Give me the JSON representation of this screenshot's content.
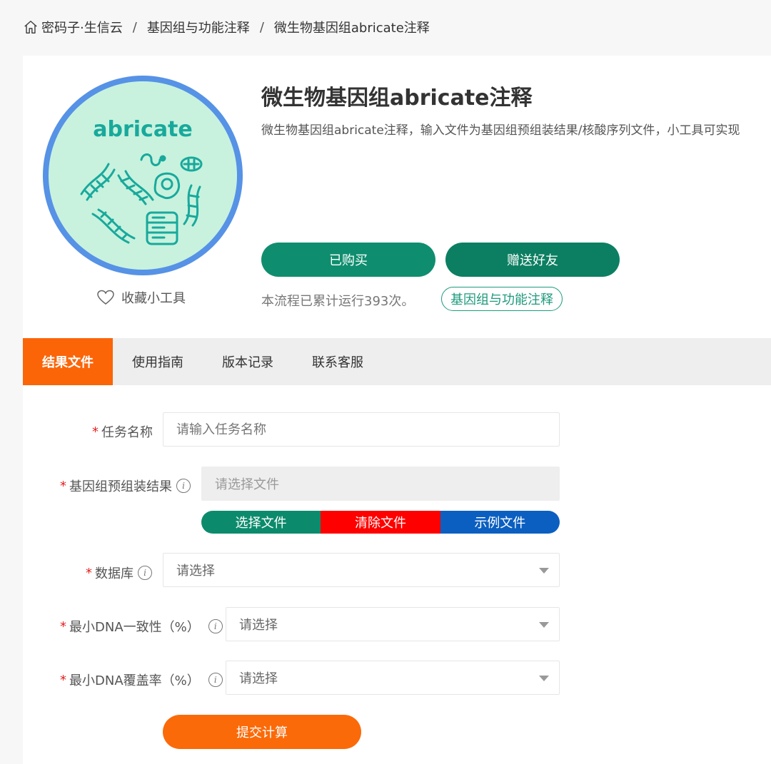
{
  "breadcrumb": {
    "home": "密码子·生信云",
    "category": "基因组与功能注释",
    "current": "微生物基因组abricate注释",
    "separator": "/"
  },
  "logo": {
    "text": "abricate",
    "icon": "dna-microbe-illustration"
  },
  "tool": {
    "title": "微生物基因组abricate注释",
    "description": "微生物基因组abricate注释，输入文件为基因组预组装结果/核酸序列文件，小工具可实现",
    "favorite_label": "收藏小工具",
    "bought_label": "已购买",
    "gift_label": "赠送好友",
    "run_count_text": "本流程已累计运行393次。",
    "tag": "基因组与功能注释"
  },
  "tabs": [
    {
      "label": "结果文件",
      "active": true
    },
    {
      "label": "使用指南",
      "active": false
    },
    {
      "label": "版本记录",
      "active": false
    },
    {
      "label": "联系客服",
      "active": false
    }
  ],
  "form": {
    "task_name": {
      "label": "任务名称",
      "placeholder": "请输入任务名称",
      "required": "*"
    },
    "assembly": {
      "label": "基因组预组装结果",
      "placeholder": "请选择文件",
      "required": "*"
    },
    "file_buttons": {
      "select": "选择文件",
      "clear": "清除文件",
      "example": "示例文件"
    },
    "database": {
      "label": "数据库",
      "value": "请选择",
      "required": "*"
    },
    "min_identity": {
      "label": "最小DNA一致性（%）",
      "value": "请选择",
      "required": "*"
    },
    "min_coverage": {
      "label": "最小DNA覆盖率（%）",
      "value": "请选择",
      "required": "*"
    },
    "submit_label": "提交计算"
  },
  "colors": {
    "accent_orange": "#fb6508",
    "brand_green": "#0b8b6e",
    "logo_ring": "#5692e6",
    "logo_bg": "#c8f2de",
    "clear_red": "#ff0000",
    "example_blue": "#0b5fc0"
  }
}
